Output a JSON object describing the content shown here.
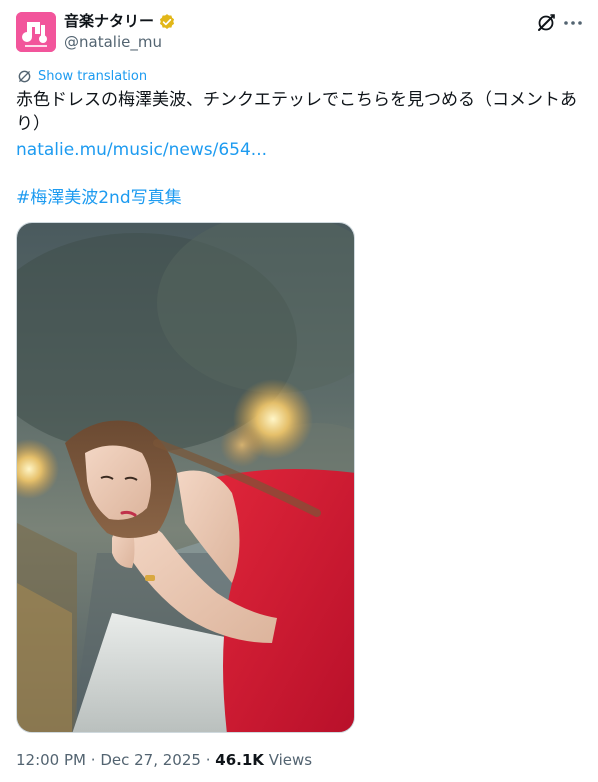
{
  "account": {
    "display_name": "音楽ナタリー",
    "handle": "@natalie_mu",
    "avatar_icon": "natalie-logo-icon",
    "brand_color": "#f2559b",
    "verified_color": "#e2b719"
  },
  "tweet": {
    "show_translation": "Show translation",
    "text": "赤色ドレスの梅澤美波、チンクエテッレでこちらを見つめる（コメントあり）",
    "link": "natalie.mu/music/news/654...",
    "hashtag": "#梅澤美波2nd写真集",
    "photo_alt": "photo-woman-in-red-dress"
  },
  "meta": {
    "time": "12:00 PM",
    "separator": "·",
    "date": "Dec 27, 2025",
    "views_count": "46.1K",
    "views_label": "Views"
  },
  "colors": {
    "link": "#1d9bf0",
    "secondary_text": "#536471",
    "primary_text": "#0f1419"
  }
}
